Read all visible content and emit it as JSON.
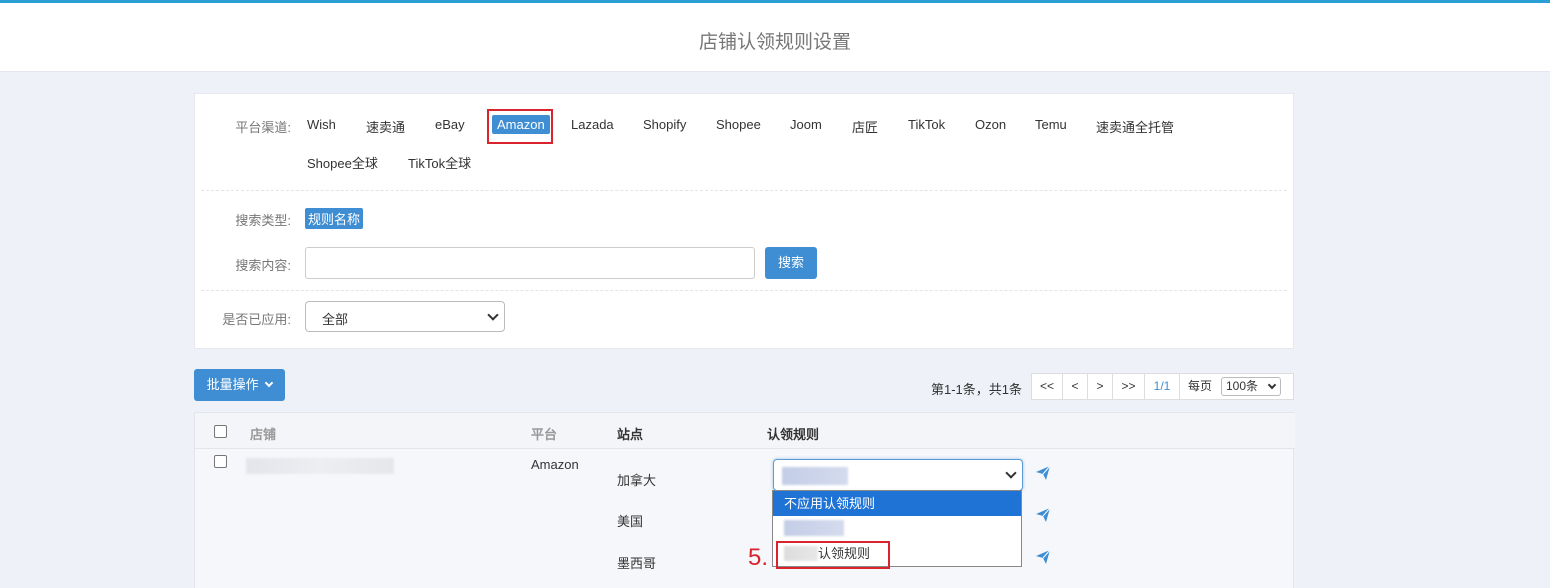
{
  "header": {
    "title": "店铺认领规则设置"
  },
  "filters": {
    "platform_label": "平台渠道:",
    "platforms": [
      "Wish",
      "速卖通",
      "eBay",
      "Amazon",
      "Lazada",
      "Shopify",
      "Shopee",
      "Joom",
      "店匠",
      "TikTok",
      "Ozon",
      "Temu",
      "速卖通全托管",
      "Shopee全球",
      "TikTok全球"
    ],
    "active_platform": "Amazon",
    "search_type_label": "搜索类型:",
    "search_type_value": "规则名称",
    "search_content_label": "搜索内容:",
    "search_value": "",
    "search_button": "搜索",
    "applied_label": "是否已应用:",
    "applied_value": "全部"
  },
  "toolbar": {
    "bulk_button": "批量操作"
  },
  "pagination": {
    "info": "第1-1条，共1条",
    "first": "<<",
    "prev": "<",
    "next": ">",
    "last": ">>",
    "page": "1/1",
    "per_page_label": "每页",
    "per_page_value": "100条"
  },
  "table": {
    "headers": {
      "shop": "店铺",
      "platform": "平台",
      "site": "站点",
      "rule": "认领规则"
    },
    "row": {
      "platform": "Amazon",
      "sites": [
        "加拿大",
        "美国",
        "墨西哥"
      ]
    }
  },
  "dropdown": {
    "options": [
      "不应用认领规则",
      "",
      "认领规则"
    ],
    "selected_index": 0
  },
  "annotation": {
    "step": "5."
  },
  "colors": {
    "accent": "#3f8ed3",
    "highlight": "#d9232d",
    "selected": "#1f73d5"
  },
  "icons": {
    "send": "paper-plane-icon",
    "bulk_caret": "chevron-down-icon"
  }
}
